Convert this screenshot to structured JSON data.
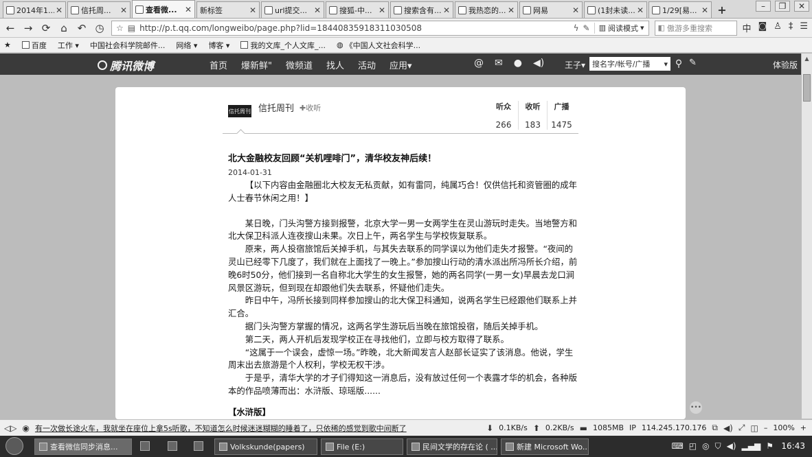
{
  "tabs": [
    {
      "label": "2014年1..."
    },
    {
      "label": "信托周..."
    },
    {
      "label": "查看微..."
    },
    {
      "label": "新标签"
    },
    {
      "label": "url提交..."
    },
    {
      "label": "搜狐-中..."
    },
    {
      "label": "搜索含有..."
    },
    {
      "label": "我热恋的..."
    },
    {
      "label": "网易"
    },
    {
      "label": "(1封未读..."
    },
    {
      "label": "1/29[易..."
    }
  ],
  "address": {
    "url": "http://p.t.qq.com/longweibo/page.php?lid=18440835918311030508",
    "read_mode": "阅读模式",
    "search_placeholder": "傲游多重搜索"
  },
  "bookmarks": [
    {
      "label": "百度"
    },
    {
      "label": "工作 ▾"
    },
    {
      "label": "中国社会科学院邮件..."
    },
    {
      "label": "网络 ▾"
    },
    {
      "label": "博客 ▾"
    },
    {
      "label": "我的文库_个人文库_..."
    },
    {
      "label": "《中国人文社会科学..."
    }
  ],
  "weibo": {
    "logo": "腾讯微博",
    "nav": [
      "首页",
      "爆新鲜\"",
      "微频道",
      "找人",
      "活动",
      "应用▾"
    ],
    "user": "王子▾",
    "search_value": "搜名字/帐号/广播",
    "trial": "体验版"
  },
  "profile": {
    "avatar_text": "信托周刊",
    "name": "信托周刊",
    "follow": "✚收听",
    "stats": [
      {
        "label": "听众",
        "value": "266"
      },
      {
        "label": "收听",
        "value": "183"
      },
      {
        "label": "广播",
        "value": "1475"
      }
    ]
  },
  "article": {
    "title": "北大金融校友回顾“关机哩啡门”，清华校友神后续！",
    "date": "2014-01-31",
    "lead": "【以下内容由金融圈北大校友无私贡献，如有雷同，纯属巧合！仅供信托和资管圈的成年人士春节休闲之用！】",
    "paragraphs": [
      "某日晚，门头沟警方接到报警，北京大学一男一女两学生在灵山游玩时走失。当地警方和北大保卫科派人连夜搜山未果。次日上午，两名学生与学校恢复联系。",
      "原来，两人投宿旅馆后关掉手机，与其失去联系的同学误以为他们走失才报警。“夜间的灵山已经零下几度了，我们就在上面找了一晚上。”参加搜山行动的清水派出所冯所长介绍，前晚6时50分，他们接到一名自称北大学生的女生报警，她的两名同学(一男一女)早晨去龙口涧风景区游玩，但到现在却跟他们失去联系，怀疑他们走失。",
      "昨日中午，冯所长接到同样参加搜山的北大保卫科通知，说两名学生已经跟他们联系上并汇合。",
      "据门头沟警方掌握的情况，这两名学生游玩后当晚在旅馆投宿，随后关掉手机。",
      "第二天，两人开机后发现学校正在寻找他们，立即与校方取得了联系。",
      "“这属于一个误会，虚惊一场。”昨晚，北大新闻发言人赵部长证实了该消息。他说，学生周末出去旅游是个人权利，学校无权干涉。",
      "于是乎，清华大学的才子们得知这一消息后，没有放过任何一个表露才华的机会，各种版本的作品喷薄而出：水浒版、琼瑶版......"
    ],
    "section_head": "【水浒版】"
  },
  "statusbar": {
    "news": "有一次做长途火车，我就坐在座位上拿5s听歌，不知道怎么时候迷迷糊糊的睡着了，只依稀的感觉到歌中间断了",
    "net_down": "0.1KB/s",
    "net_up": "0.2KB/s",
    "memory": "1085MB",
    "ip": "114.245.170.176",
    "zoom": "100%"
  },
  "taskbar": {
    "tasks": [
      {
        "label": "查看微信同步消息..."
      },
      {
        "label": "Volkskunde(papers)"
      },
      {
        "label": "File (E:)"
      },
      {
        "label": "民间文学的存在论 ( ..."
      },
      {
        "label": "新建 Microsoft Wo..."
      }
    ],
    "clock": "16:43"
  }
}
